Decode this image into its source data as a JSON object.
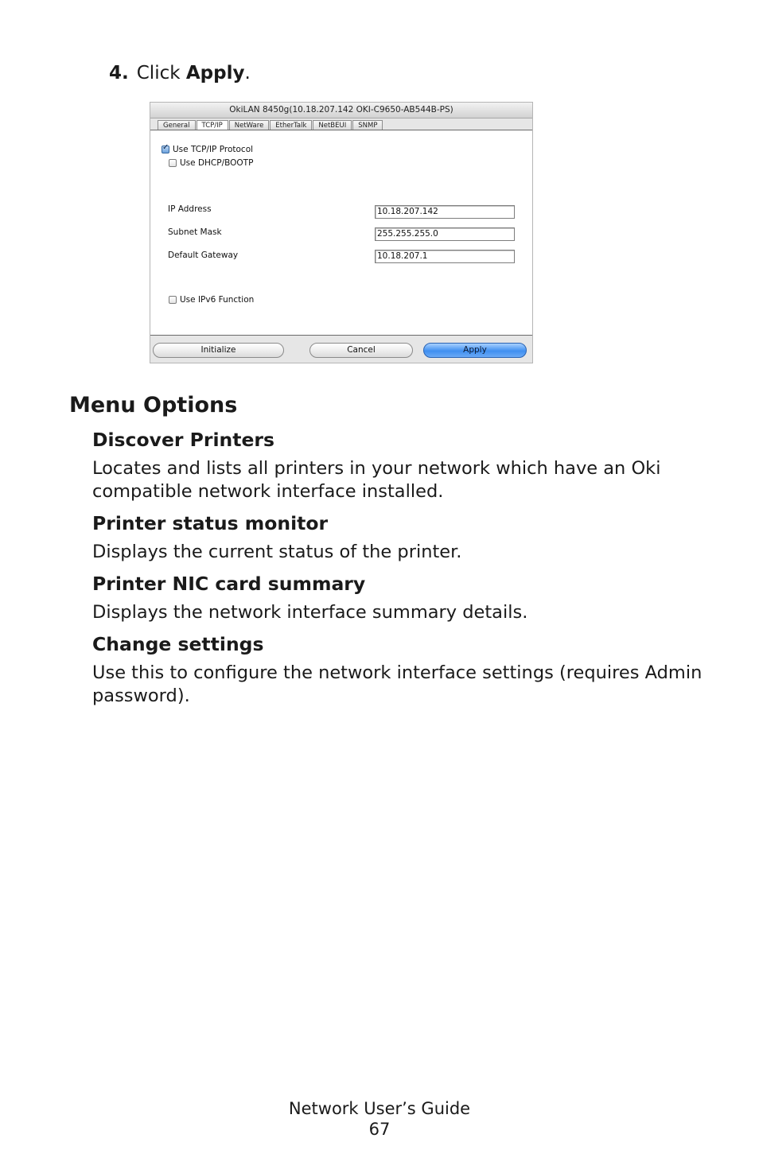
{
  "step": {
    "number": "4.",
    "text_before": "Click",
    "bold": "Apply",
    "text_after": "."
  },
  "screenshot": {
    "title": "OkiLAN 8450g(10.18.207.142 OKI-C9650-AB544B-PS)",
    "tabs": [
      "General",
      "TCP/IP",
      "NetWare",
      "EtherTalk",
      "NetBEUI",
      "SNMP"
    ],
    "active_tab": "TCP/IP",
    "checkboxes": {
      "use_tcpip": {
        "label": "Use TCP/IP Protocol",
        "checked": true
      },
      "use_dhcp": {
        "label": "Use DHCP/BOOTP",
        "checked": false
      },
      "use_ipv6": {
        "label": "Use IPv6 Function",
        "checked": false
      }
    },
    "fields": {
      "ip_address": {
        "label": "IP Address",
        "value": "10.18.207.142"
      },
      "subnet_mask": {
        "label": "Subnet Mask",
        "value": "255.255.255.0"
      },
      "default_gateway": {
        "label": "Default Gateway",
        "value": "10.18.207.1"
      }
    },
    "buttons": {
      "initialize": "Initialize",
      "cancel": "Cancel",
      "apply": "Apply"
    }
  },
  "section": {
    "heading": "Menu Options",
    "items": [
      {
        "title": "Discover Printers",
        "body": "Locates and lists all printers in your network which have an Oki compatible network interface installed."
      },
      {
        "title": "Printer status monitor",
        "body": "Displays the current status of the printer."
      },
      {
        "title": "Printer NIC card summary",
        "body": "Displays the network interface summary details."
      },
      {
        "title": "Change settings",
        "body": "Use this to configure the network interface settings (requires Admin password)."
      }
    ]
  },
  "footer": {
    "guide": "Network User’s Guide",
    "page": "67"
  }
}
